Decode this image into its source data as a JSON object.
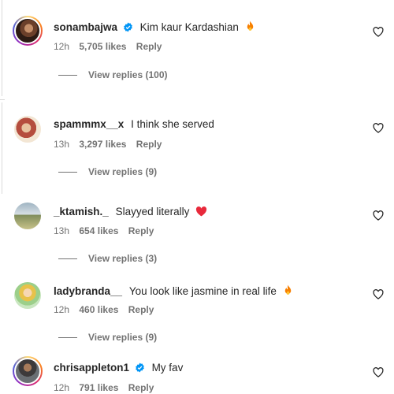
{
  "comments": [
    {
      "username": "sonambajwa",
      "verified": true,
      "text": "Kim kaur Kardashian",
      "emoji": "fire-icon",
      "time": "12h",
      "likes": "5,705 likes",
      "reply": "Reply",
      "view_replies": "View replies (100)"
    },
    {
      "username": "spammmx__x",
      "verified": false,
      "text": "I think she served",
      "emoji": "",
      "time": "13h",
      "likes": "3,297 likes",
      "reply": "Reply",
      "view_replies": "View replies (9)"
    },
    {
      "username": "_ktamish._",
      "verified": false,
      "text": "Slayyed literally",
      "emoji": "red-heart-icon",
      "time": "13h",
      "likes": "654 likes",
      "reply": "Reply",
      "view_replies": "View replies (3)"
    },
    {
      "username": "ladybranda__",
      "verified": false,
      "text": "You look like jasmine in real life",
      "emoji": "fire-icon",
      "time": "12h",
      "likes": "460 likes",
      "reply": "Reply",
      "view_replies": "View replies (9)"
    },
    {
      "username": "chrisappleton1",
      "verified": true,
      "text": "My fav",
      "emoji": "",
      "time": "12h",
      "likes": "791 likes",
      "reply": "Reply",
      "view_replies": ""
    }
  ],
  "colors": {
    "text": "#262626",
    "secondary": "#737373",
    "verified": "#0095f6",
    "fire": "#f77f00",
    "heart_emoji": "#e8293b"
  }
}
